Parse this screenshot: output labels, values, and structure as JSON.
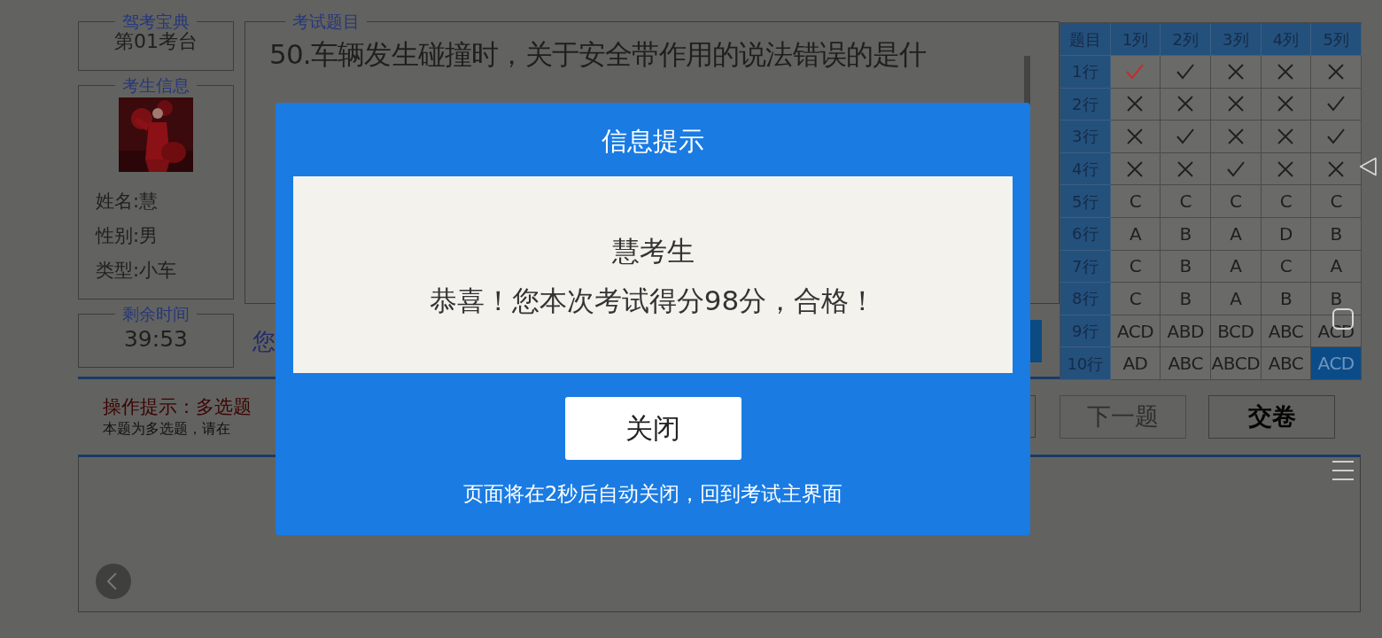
{
  "station": {
    "legend": "驾考宝典",
    "value": "第01考台"
  },
  "examinee": {
    "legend": "考生信息",
    "fields": [
      "姓名:慧",
      "性别:男",
      "类型:小车"
    ]
  },
  "timer": {
    "legend": "剩余时间",
    "value": "39:53"
  },
  "question": {
    "legend": "考试题目",
    "text": "50.车辆发生碰撞时，关于安全带作用的说法错误的是什"
  },
  "answer_prompt": "您",
  "answer_grid": {
    "corner": "题目",
    "columns": [
      "1列",
      "2列",
      "3列",
      "4列",
      "5列"
    ],
    "rows": [
      {
        "label": "1行",
        "cells": [
          {
            "kind": "check",
            "selected": false,
            "color": "#c42b2b"
          },
          {
            "kind": "check",
            "selected": false
          },
          {
            "kind": "cross",
            "selected": false
          },
          {
            "kind": "cross",
            "selected": false
          },
          {
            "kind": "cross",
            "selected": false
          }
        ]
      },
      {
        "label": "2行",
        "cells": [
          {
            "kind": "cross",
            "selected": false
          },
          {
            "kind": "cross",
            "selected": false
          },
          {
            "kind": "cross",
            "selected": false
          },
          {
            "kind": "cross",
            "selected": false
          },
          {
            "kind": "check",
            "selected": false
          }
        ]
      },
      {
        "label": "3行",
        "cells": [
          {
            "kind": "cross",
            "selected": false
          },
          {
            "kind": "check",
            "selected": false
          },
          {
            "kind": "cross",
            "selected": false
          },
          {
            "kind": "cross",
            "selected": false
          },
          {
            "kind": "check",
            "selected": false
          }
        ]
      },
      {
        "label": "4行",
        "cells": [
          {
            "kind": "cross",
            "selected": false
          },
          {
            "kind": "cross",
            "selected": false
          },
          {
            "kind": "check",
            "selected": false
          },
          {
            "kind": "cross",
            "selected": false
          },
          {
            "kind": "cross",
            "selected": false
          }
        ]
      },
      {
        "label": "5行",
        "cells": [
          {
            "kind": "text",
            "text": "C",
            "selected": false
          },
          {
            "kind": "text",
            "text": "C",
            "selected": false
          },
          {
            "kind": "text",
            "text": "C",
            "selected": false
          },
          {
            "kind": "text",
            "text": "C",
            "selected": false
          },
          {
            "kind": "text",
            "text": "C",
            "selected": false
          }
        ]
      },
      {
        "label": "6行",
        "cells": [
          {
            "kind": "text",
            "text": "A",
            "selected": false
          },
          {
            "kind": "text",
            "text": "B",
            "selected": false
          },
          {
            "kind": "text",
            "text": "A",
            "selected": false
          },
          {
            "kind": "text",
            "text": "D",
            "selected": false
          },
          {
            "kind": "text",
            "text": "B",
            "selected": false
          }
        ]
      },
      {
        "label": "7行",
        "cells": [
          {
            "kind": "text",
            "text": "C",
            "selected": false
          },
          {
            "kind": "text",
            "text": "B",
            "selected": false
          },
          {
            "kind": "text",
            "text": "A",
            "selected": false
          },
          {
            "kind": "text",
            "text": "C",
            "selected": false
          },
          {
            "kind": "text",
            "text": "A",
            "selected": false
          }
        ]
      },
      {
        "label": "8行",
        "cells": [
          {
            "kind": "text",
            "text": "C",
            "selected": false
          },
          {
            "kind": "text",
            "text": "B",
            "selected": false
          },
          {
            "kind": "text",
            "text": "A",
            "selected": false
          },
          {
            "kind": "text",
            "text": "B",
            "selected": false
          },
          {
            "kind": "text",
            "text": "B",
            "selected": false
          }
        ]
      },
      {
        "label": "9行",
        "cells": [
          {
            "kind": "text",
            "text": "ACD",
            "selected": false
          },
          {
            "kind": "text",
            "text": "ABD",
            "selected": false
          },
          {
            "kind": "text",
            "text": "BCD",
            "selected": false
          },
          {
            "kind": "text",
            "text": "ABC",
            "selected": false
          },
          {
            "kind": "text",
            "text": "ACD",
            "selected": false
          }
        ]
      },
      {
        "label": "10行",
        "cells": [
          {
            "kind": "text",
            "text": "AD",
            "selected": false
          },
          {
            "kind": "text",
            "text": "ABC",
            "selected": false
          },
          {
            "kind": "text",
            "text": "ABCD",
            "selected": false
          },
          {
            "kind": "text",
            "text": "ABC",
            "selected": false
          },
          {
            "kind": "text",
            "text": "ACD",
            "selected": true
          }
        ]
      }
    ]
  },
  "hint": {
    "title": "操作提示：多选题",
    "text": "本题为多选题，请在"
  },
  "buttons": [
    {
      "label": "下一题",
      "disabled": true
    },
    {
      "label": "交卷",
      "disabled": false
    }
  ],
  "dialog": {
    "title": "信息提示",
    "name": "慧考生",
    "message": "恭喜！您本次考试得分98分，合格！",
    "button": "关闭",
    "footer": "页面将在2秒后自动关闭，回到考试主界面"
  }
}
